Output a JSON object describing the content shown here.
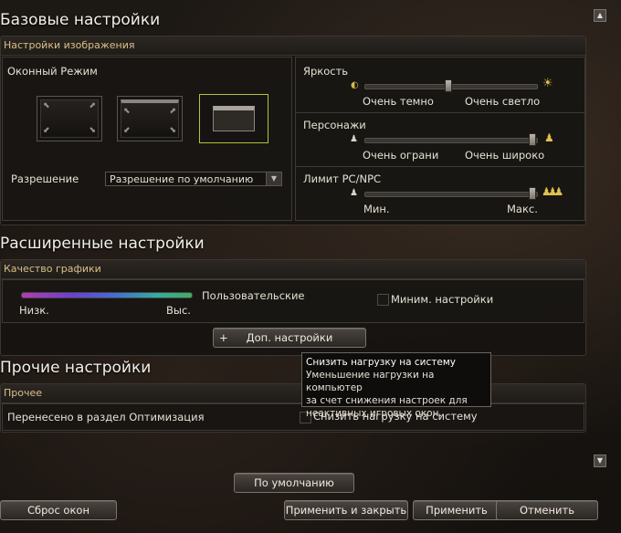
{
  "basic": {
    "title": "Базовые настройки",
    "image_settings_header": "Настройки изображения",
    "window_mode_label": "Оконный Режим",
    "resolution_label": "Разрешение",
    "resolution_value": "Разрешение по умолчанию",
    "brightness": {
      "label": "Яркость",
      "min_label": "Очень темно",
      "max_label": "Очень светло",
      "level": 0.5
    },
    "characters": {
      "label": "Персонажи",
      "min_label": "Очень ограни",
      "max_label": "Очень широко",
      "level": 1.0
    },
    "pc_npc_limit": {
      "label": "Лимит PC/NPC",
      "min_label": "Мин.",
      "max_label": "Макс.",
      "level": 1.0
    }
  },
  "advanced": {
    "title": "Расширенные настройки",
    "graphics_header": "Качество графики",
    "low_label": "Низк.",
    "high_label": "Выс.",
    "preset_label": "Пользовательские",
    "min_settings_label": "Миним. настройки",
    "extra_button": "Доп. настройки",
    "extra_button_icon": "+"
  },
  "other": {
    "title": "Прочие настройки",
    "header": "Прочее",
    "moved_text": "Перенесено в раздел Оптимизация",
    "reduce_load_label": "Снизить нагрузку на систему"
  },
  "tooltip": {
    "title": "Снизить нагрузку на систему",
    "lines": [
      "Уменьшение нагрузки на компьютер",
      "за счет снижения настроек для",
      "неактивных игровых окон."
    ]
  },
  "footer": {
    "default_button": "По умолчанию",
    "reset_windows": "Сброс окон",
    "apply_close": "Применить и закрыть",
    "apply": "Применить",
    "cancel": "Отменить"
  },
  "colors": {
    "accent_selected": "#b5c23a",
    "header_text": "#d9c08a"
  }
}
